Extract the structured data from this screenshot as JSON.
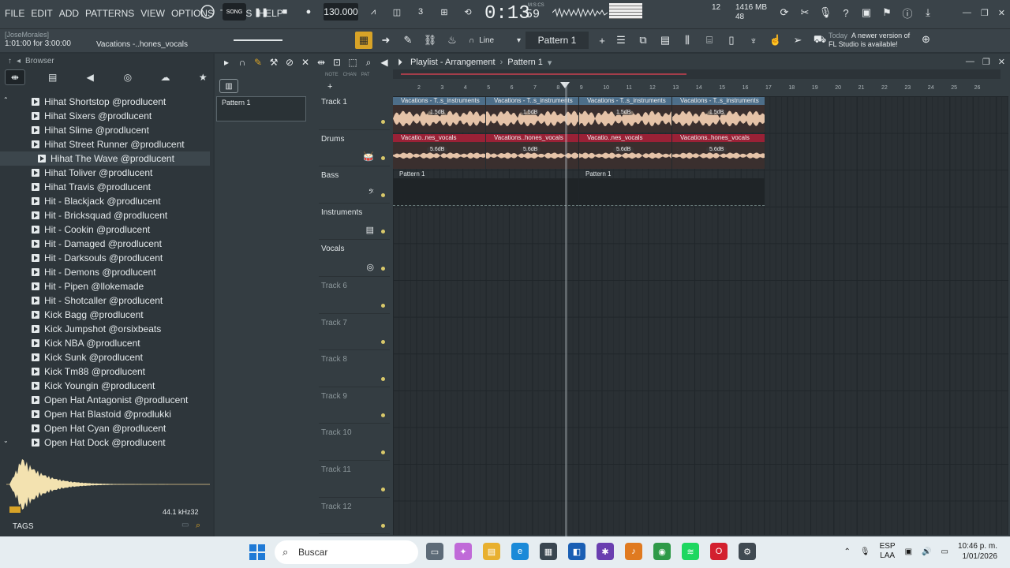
{
  "menu": [
    "FILE",
    "EDIT",
    "ADD",
    "PATTERNS",
    "VIEW",
    "OPTIONS",
    "TOOLS",
    "HELP"
  ],
  "transport": {
    "mode_pat": "PAT",
    "mode_song": "SONG",
    "tempo": "130.000",
    "time": "0:13",
    "time_cs": "59",
    "time_unit": "M:S:CS",
    "cpu": "12",
    "memory": "1416 MB",
    "memory_sub": "48"
  },
  "user": {
    "name": "[JoseMorales]",
    "position": "1:01:00 for 3:00:00",
    "hint": "Vacations -..hones_vocals"
  },
  "toolbar": {
    "snap": "Line",
    "pattern": "Pattern 1"
  },
  "news": {
    "today": "Today",
    "message_line1": "A newer version of",
    "message_line2": "FL Studio is available!"
  },
  "browser": {
    "title": "Browser",
    "items": [
      "Hihat Shortstop @prodlucent",
      "Hihat Sixers @prodlucent",
      "Hihat Slime @prodlucent",
      "Hihat Street Runner @prodlucent",
      "Hihat The Wave @prodlucent",
      "Hihat Toliver @prodlucent",
      "Hihat Travis @prodlucent",
      "Hit - Blackjack @prodlucent",
      "Hit - Bricksquad @prodlucent",
      "Hit - Cookin @prodlucent",
      "Hit - Damaged @prodlucent",
      "Hit - Darksouls @prodlucent",
      "Hit - Demons @prodlucent",
      "Hit - Pipen @llokemade",
      "Hit - Shotcaller @prodlucent",
      "Kick Bagg @prodlucent",
      "Kick Jumpshot @orsixbeats",
      "Kick NBA @prodlucent",
      "Kick Sunk @prodlucent",
      "Kick Tm88 @prodlucent",
      "Kick Youngin @prodlucent",
      "Open Hat Antagonist @prodlucent",
      "Open Hat Blastoid @prodlukki",
      "Open Hat Cyan @prodlucent",
      "Open Hat Dock @prodlucent"
    ],
    "selected_index": 4,
    "sample_rate": "44.1 kHz",
    "bit_depth": "32",
    "tags_label": "TAGS"
  },
  "playlist": {
    "title": "Playlist - Arrangement",
    "pattern": "Pattern 1",
    "picker_pattern": "Pattern 1",
    "mode_labels": [
      "NOTE",
      "CHAN",
      "PAT"
    ],
    "tracks": [
      "Track 1",
      "Drums",
      "Bass",
      "Instruments",
      "Vocals",
      "Track 6",
      "Track 7",
      "Track 8",
      "Track 9",
      "Track 10",
      "Track 11",
      "Track 12"
    ],
    "ruler": [
      "2",
      "3",
      "4",
      "5",
      "6",
      "7",
      "8",
      "9",
      "10",
      "11",
      "12",
      "13",
      "14",
      "15",
      "16",
      "17",
      "18",
      "19",
      "20",
      "21",
      "22",
      "23",
      "24",
      "25",
      "26"
    ],
    "instrument_clip": "Vacations - T..s_instruments",
    "instrument_gain": "1.5dB",
    "vocal_clips": [
      "Vacatio..nes_vocals",
      "Vacations..hones_vocals",
      "Vacatio..nes_vocals",
      "Vacations..hones_vocals"
    ],
    "vocal_gain": "5.6dB",
    "bass_clip": "Pattern 1"
  },
  "taskbar": {
    "search_placeholder": "Buscar",
    "lang": "ESP",
    "lang_sub": "LAA",
    "time": "10:46 p. m.",
    "date": "1/01/2026"
  },
  "colors": {
    "accent": "#d8a327",
    "instrument_clip": "#4d6e89",
    "vocal_clip": "#9a2136",
    "waveform": "#e5c3a8"
  }
}
